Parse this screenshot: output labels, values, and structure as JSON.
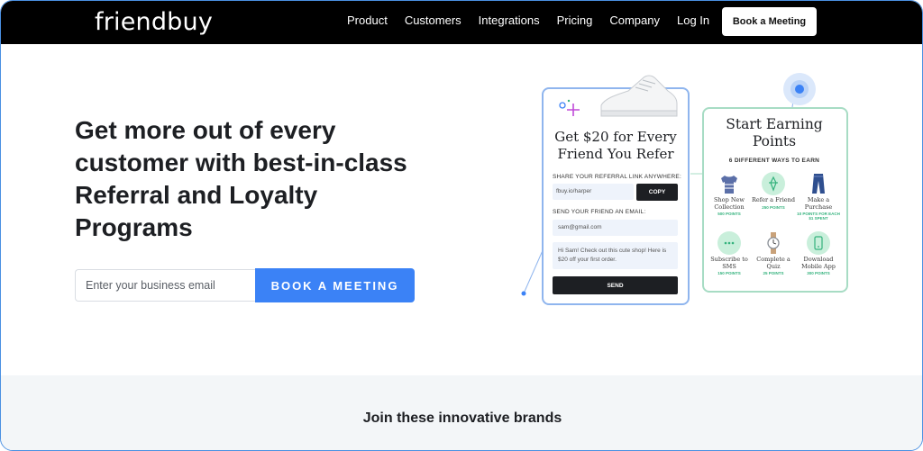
{
  "nav": {
    "logo": "friendbuy",
    "links": [
      "Product",
      "Customers",
      "Integrations",
      "Pricing",
      "Company",
      "Log In"
    ],
    "cta": "Book a Meeting"
  },
  "hero": {
    "headline": "Get more out of every customer with best-in-class Referral and Loyalty Programs",
    "email_placeholder": "Enter your business email",
    "cta": "BOOK A MEETING"
  },
  "referral_card": {
    "title": "Get $20 for Every Friend You Refer",
    "share_label": "SHARE YOUR REFERRAL LINK ANYWHERE:",
    "link": "fbuy.io/harper",
    "copy": "COPY",
    "email_label": "SEND YOUR FRIEND AN EMAIL:",
    "email_value": "sam@gmail.com",
    "message": "Hi Sam! Check out this cute shop! Here is $20 off your first order.",
    "send": "SEND"
  },
  "loyalty_card": {
    "title": "Start Earning Points",
    "subtitle": "6 DIFFERENT WAYS TO EARN",
    "ways": [
      {
        "label": "Shop New Collection",
        "points": "500 POINTS",
        "icon": "tshirt-icon"
      },
      {
        "label": "Refer a Friend",
        "points": "250 POINTS",
        "icon": "gift-icon"
      },
      {
        "label": "Make a Purchase",
        "points": "10 POINTS FOR EACH $1 SPENT",
        "icon": "jeans-icon"
      },
      {
        "label": "Subscribe to SMS",
        "points": "150 POINTS",
        "icon": "chat-icon"
      },
      {
        "label": "Complete a Quiz",
        "points": "25 POINTS",
        "icon": "watch-icon"
      },
      {
        "label": "Download Mobile App",
        "points": "300 POINTS",
        "icon": "phone-icon"
      }
    ]
  },
  "brands": {
    "title": "Join these innovative brands"
  },
  "colors": {
    "accent": "#3b82f6",
    "nav_bg": "#000000",
    "loyalty_green": "#34b27d"
  }
}
